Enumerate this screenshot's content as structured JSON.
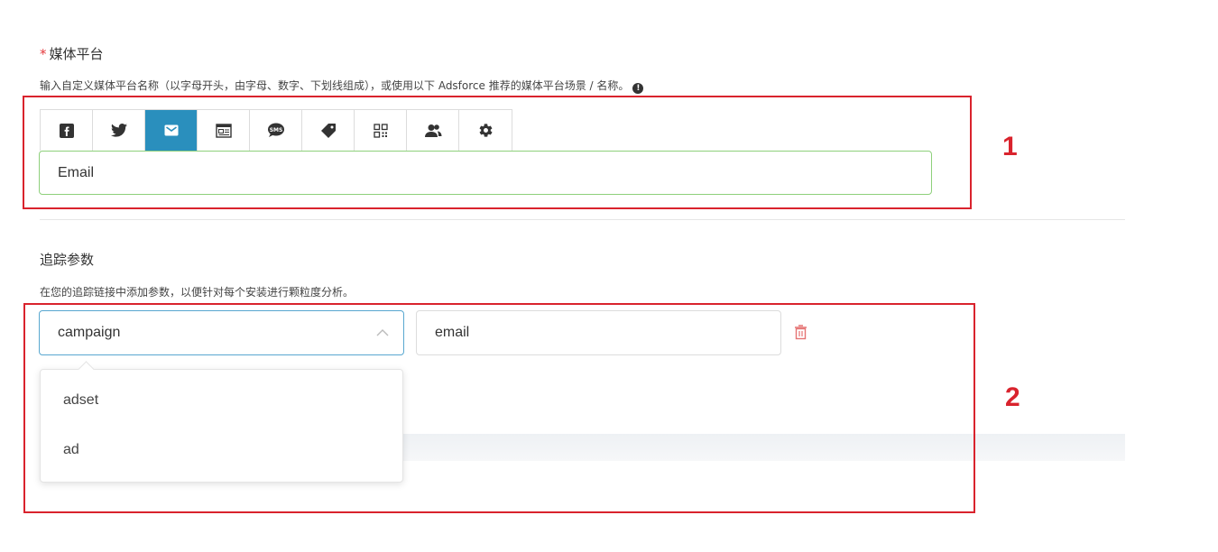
{
  "media_platform": {
    "required_mark": "*",
    "title": "媒体平台",
    "description": "输入自定义媒体平台名称（以字母开头，由字母、数字、下划线组成），或使用以下 Adsforce 推荐的媒体平台场景 / 名称。",
    "info_icon": "!",
    "icons": [
      {
        "name": "facebook-icon",
        "active": false
      },
      {
        "name": "twitter-icon",
        "active": false
      },
      {
        "name": "email-icon",
        "active": true
      },
      {
        "name": "web-page-icon",
        "active": false
      },
      {
        "name": "sms-icon",
        "active": false
      },
      {
        "name": "coupon-tag-icon",
        "active": false
      },
      {
        "name": "qr-code-icon",
        "active": false
      },
      {
        "name": "users-icon",
        "active": false
      },
      {
        "name": "settings-gear-icon",
        "active": false
      }
    ],
    "input_value": "Email"
  },
  "tracking_params": {
    "title": "追踪参数",
    "description": "在您的追踪链接中添加参数，以便针对每个安装进行颗粒度分析。",
    "key_select_value": "campaign",
    "value_input_value": "email",
    "dropdown_options": [
      "adset",
      "ad"
    ]
  },
  "annotations": {
    "label_1": "1",
    "label_2": "2"
  },
  "colors": {
    "accent_blue": "#2a8fbd",
    "annotation_red": "#d9232d",
    "input_valid_green": "#8ed07b",
    "delete_red": "#e57373"
  }
}
